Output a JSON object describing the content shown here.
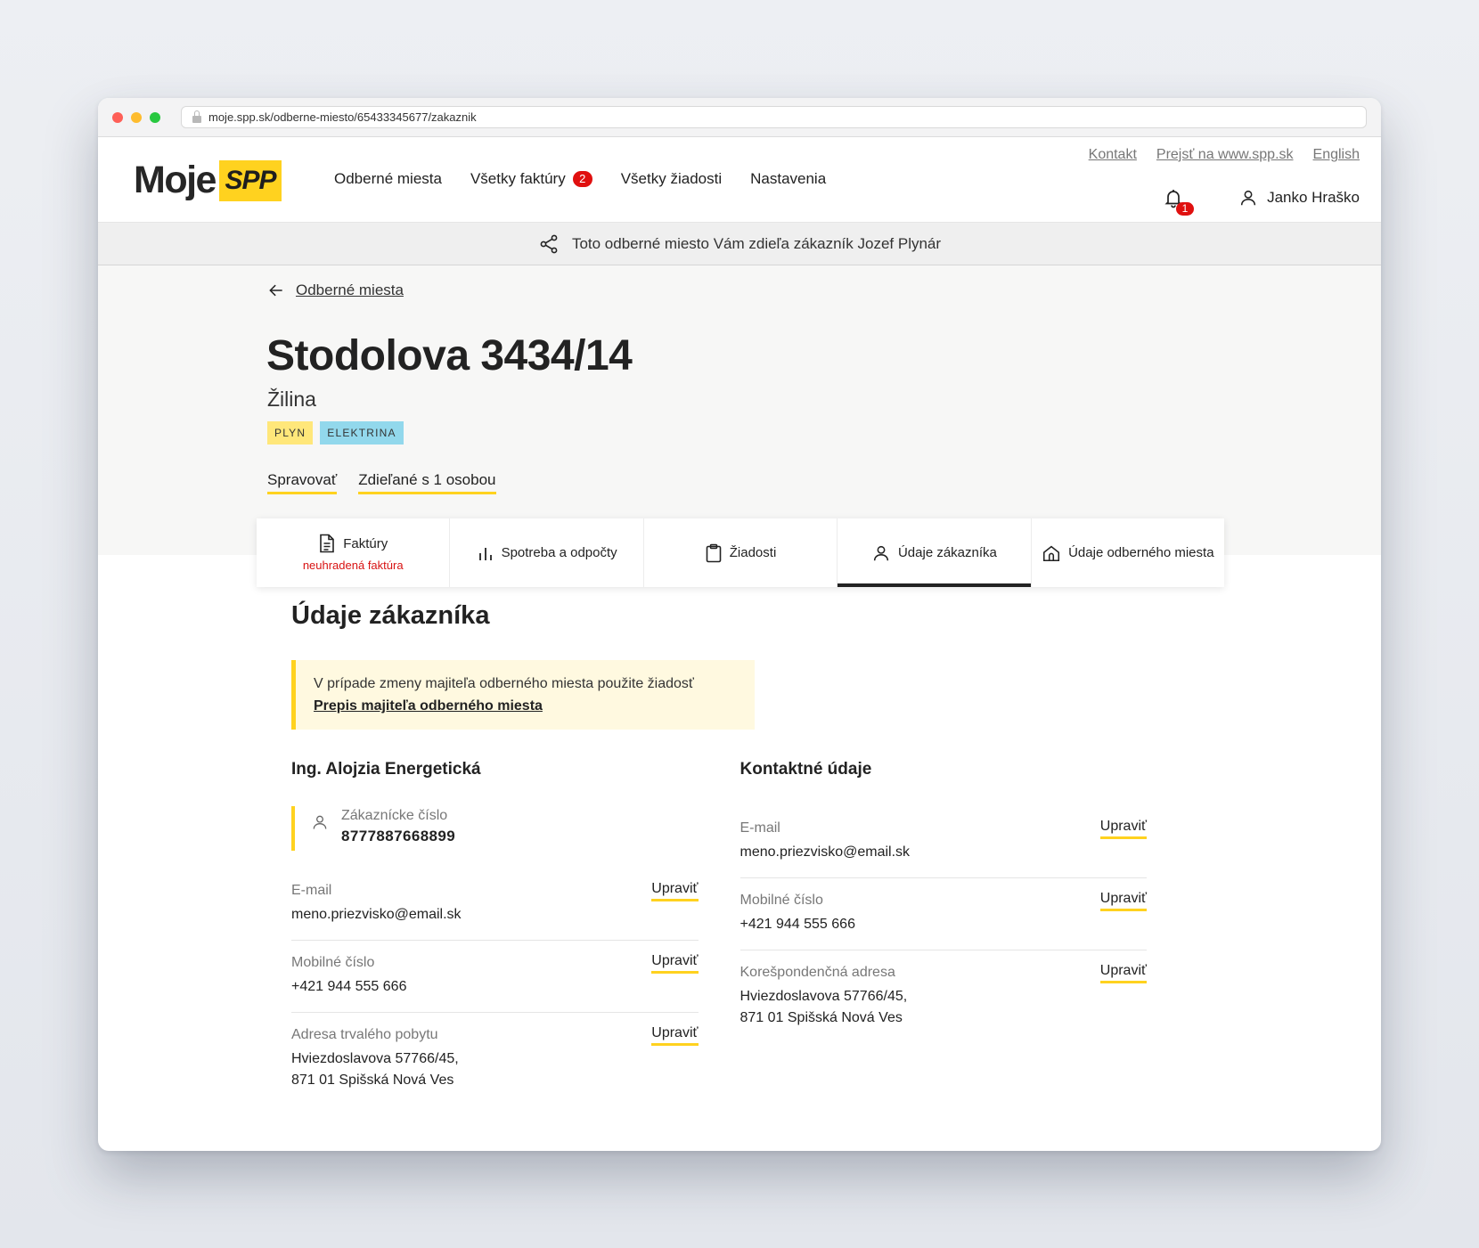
{
  "browser": {
    "url": "moje.spp.sk/odberne-miesto/65433345677/zakaznik"
  },
  "logo": {
    "text": "Moje",
    "badge": "SPP"
  },
  "nav": {
    "items": [
      "Odberné miesta",
      "Všetky faktúry",
      "Všetky žiadosti",
      "Nastavenia"
    ],
    "invoices_badge": "2"
  },
  "toplinks": [
    "Kontakt",
    "Prejsť na www.spp.sk",
    "English"
  ],
  "notifications": {
    "count": "1",
    "icon": "bell-icon"
  },
  "user": {
    "name": "Janko Hraško",
    "icon": "user-icon"
  },
  "share_banner": {
    "text": "Toto odberné miesto Vám zdieľa zákazník Jozef Plynár",
    "icon": "share-icon"
  },
  "back_link": "Odberné miesta",
  "place": {
    "title": "Stodolova 3434/14",
    "city": "Žilina",
    "tags": [
      "PLYN",
      "ELEKTRINA"
    ]
  },
  "actions": [
    "Spravovať",
    "Zdieľané s 1 osobou"
  ],
  "tabs": [
    {
      "label": "Faktúry",
      "sub": "neuhradená faktúra",
      "icon": "document-icon"
    },
    {
      "label": "Spotreba a odpočty",
      "icon": "chart-icon"
    },
    {
      "label": "Žiadosti",
      "icon": "clipboard-icon"
    },
    {
      "label": "Údaje zákazníka",
      "icon": "user-icon",
      "active": true
    },
    {
      "label": "Údaje odberného miesta",
      "icon": "home-icon"
    }
  ],
  "section": {
    "title": "Údaje zákazníka",
    "notice_text": "V prípade zmeny majiteľa odberného miesta použite žiadosť",
    "notice_link": "Prepis majiteľa odberného miesta"
  },
  "customer": {
    "name": "Ing. Alojzia Energetická",
    "number_label": "Zákaznícke číslo",
    "number_value": "8777887668899",
    "fields": [
      {
        "label": "E-mail",
        "value": "meno.priezvisko@email.sk",
        "edit": "Upraviť"
      },
      {
        "label": "Mobilné číslo",
        "value": "+421 944 555 666",
        "edit": "Upraviť"
      },
      {
        "label": "Adresa trvalého pobytu",
        "value1": "Hviezdoslavova 57766/45,",
        "value2": "871 01 Spišská Nová Ves",
        "edit": "Upraviť"
      }
    ]
  },
  "contact": {
    "title": "Kontaktné údaje",
    "fields": [
      {
        "label": "E-mail",
        "value": "meno.priezvisko@email.sk",
        "edit": "Upraviť"
      },
      {
        "label": "Mobilné číslo",
        "value": "+421 944 555 666",
        "edit": "Upraviť"
      },
      {
        "label": "Korešpondenčná adresa",
        "value1": "Hviezdoslavova 57766/45,",
        "value2": "871 01 Spišská Nová Ves",
        "edit": "Upraviť"
      }
    ]
  },
  "colors": {
    "brand_yellow": "#ffd21f",
    "alert_red": "#e0100f",
    "tag_gas": "#ffe77a",
    "tag_electricity": "#92d8ec"
  }
}
